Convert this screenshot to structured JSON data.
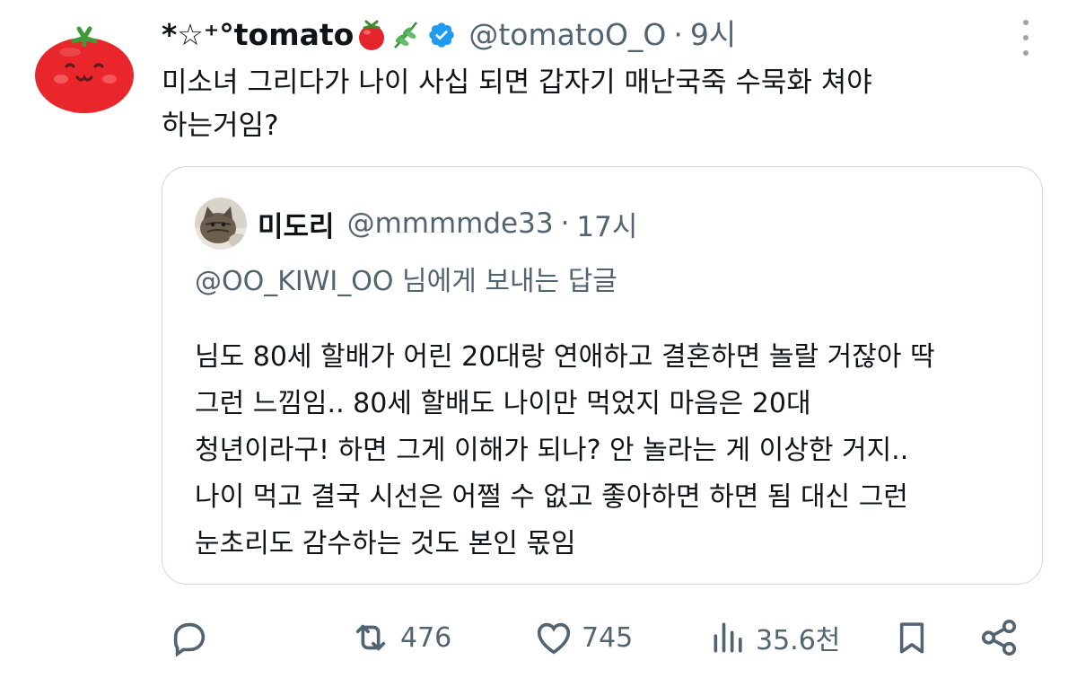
{
  "tweet": {
    "display_name": "*☆⁺°tomato",
    "handle": "@tomatoO_O",
    "separator": "·",
    "time": "9시",
    "text": "미소녀 그리다가 나이 사십 되면 갑자기 매난국죽 수묵화 쳐야\n하는거임?",
    "name_emojis": [
      "tomato-emoji",
      "herb-emoji"
    ],
    "avatar_icon": "tomato-face-avatar",
    "verified_icon": "verified-badge-icon",
    "accent_color": "#1d9bf0"
  },
  "quote": {
    "display_name": "미도리",
    "handle": "@mmmmde33",
    "separator": "·",
    "time": "17시",
    "reply_to": "@OO_KIWI_OO 님에게 보내는 답글",
    "text": "님도 80세 할배가 어린 20대랑 연애하고 결혼하면 놀랄 거잖아 딱\n그런 느낌임.. 80세 할배도 나이만 먹었지 마음은 20대\n청년이라구! 하면 그게 이해가 되나? 안 놀라는 게 이상한 거지..\n나이 먹고 결국 시선은 어쩔 수 없고 좋아하면 하면 됨 대신 그런\n눈초리도 감수하는 것도 본인 몫임",
    "avatar_icon": "cat-photo-avatar"
  },
  "actions": {
    "reply_icon": "reply-icon",
    "retweet_icon": "retweet-icon",
    "retweet_count": "476",
    "like_icon": "heart-icon",
    "like_count": "745",
    "views_icon": "views-icon",
    "views_count": "35.6천",
    "bookmark_icon": "bookmark-icon",
    "share_icon": "share-icon"
  }
}
